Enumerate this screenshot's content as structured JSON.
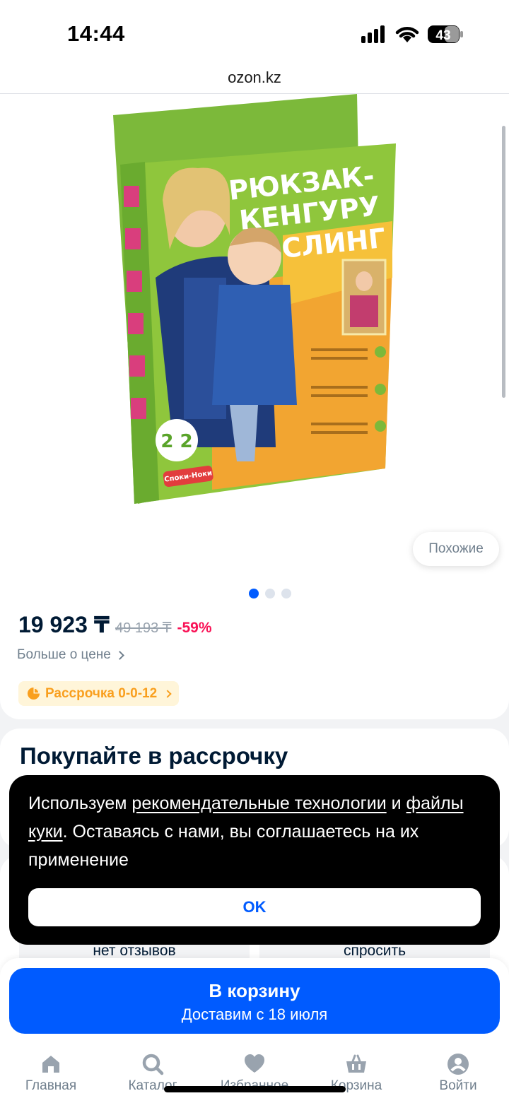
{
  "status_bar": {
    "time": "14:44",
    "battery": "43"
  },
  "browser": {
    "url": "ozon.kz"
  },
  "product": {
    "image_text": {
      "line1": "РЮКЗАК-",
      "line2": "КЕНГУРУ",
      "line3": "СЛИНГ",
      "brand": "Споки-Ноки"
    },
    "similar_label": "Похожие",
    "gallery_count": 3,
    "gallery_active": 0,
    "price": {
      "current": "19 923 ₸",
      "old": "49 193 ₸",
      "discount": "-59%",
      "more_label": "Больше о цене"
    },
    "installment_badge": "Рассрочка 0-0-12"
  },
  "installment_section": {
    "title": "Покупайте в рассрочку"
  },
  "reviews_section": {
    "left_text": "нет отзывов",
    "right_text": "спросить"
  },
  "cookie_banner": {
    "text_before": "Используем ",
    "link1": "рекомендательные технологии",
    "text_mid": " и ",
    "link2": "файлы куки",
    "text_after": ". Оставаясь с нами, вы соглашаетесь на их применение",
    "ok_label": "OK"
  },
  "cart_button": {
    "label": "В корзину",
    "delivery": "Доставим с 18 июля"
  },
  "bottom_nav": {
    "items": [
      {
        "label": "Главная",
        "icon": "home-icon"
      },
      {
        "label": "Каталог",
        "icon": "search-icon"
      },
      {
        "label": "Избранное",
        "icon": "heart-icon"
      },
      {
        "label": "Корзина",
        "icon": "basket-icon"
      },
      {
        "label": "Войти",
        "icon": "user-icon"
      }
    ]
  },
  "colors": {
    "accent": "#005bff",
    "discount": "#f91155",
    "installment": "#f99f1e"
  }
}
